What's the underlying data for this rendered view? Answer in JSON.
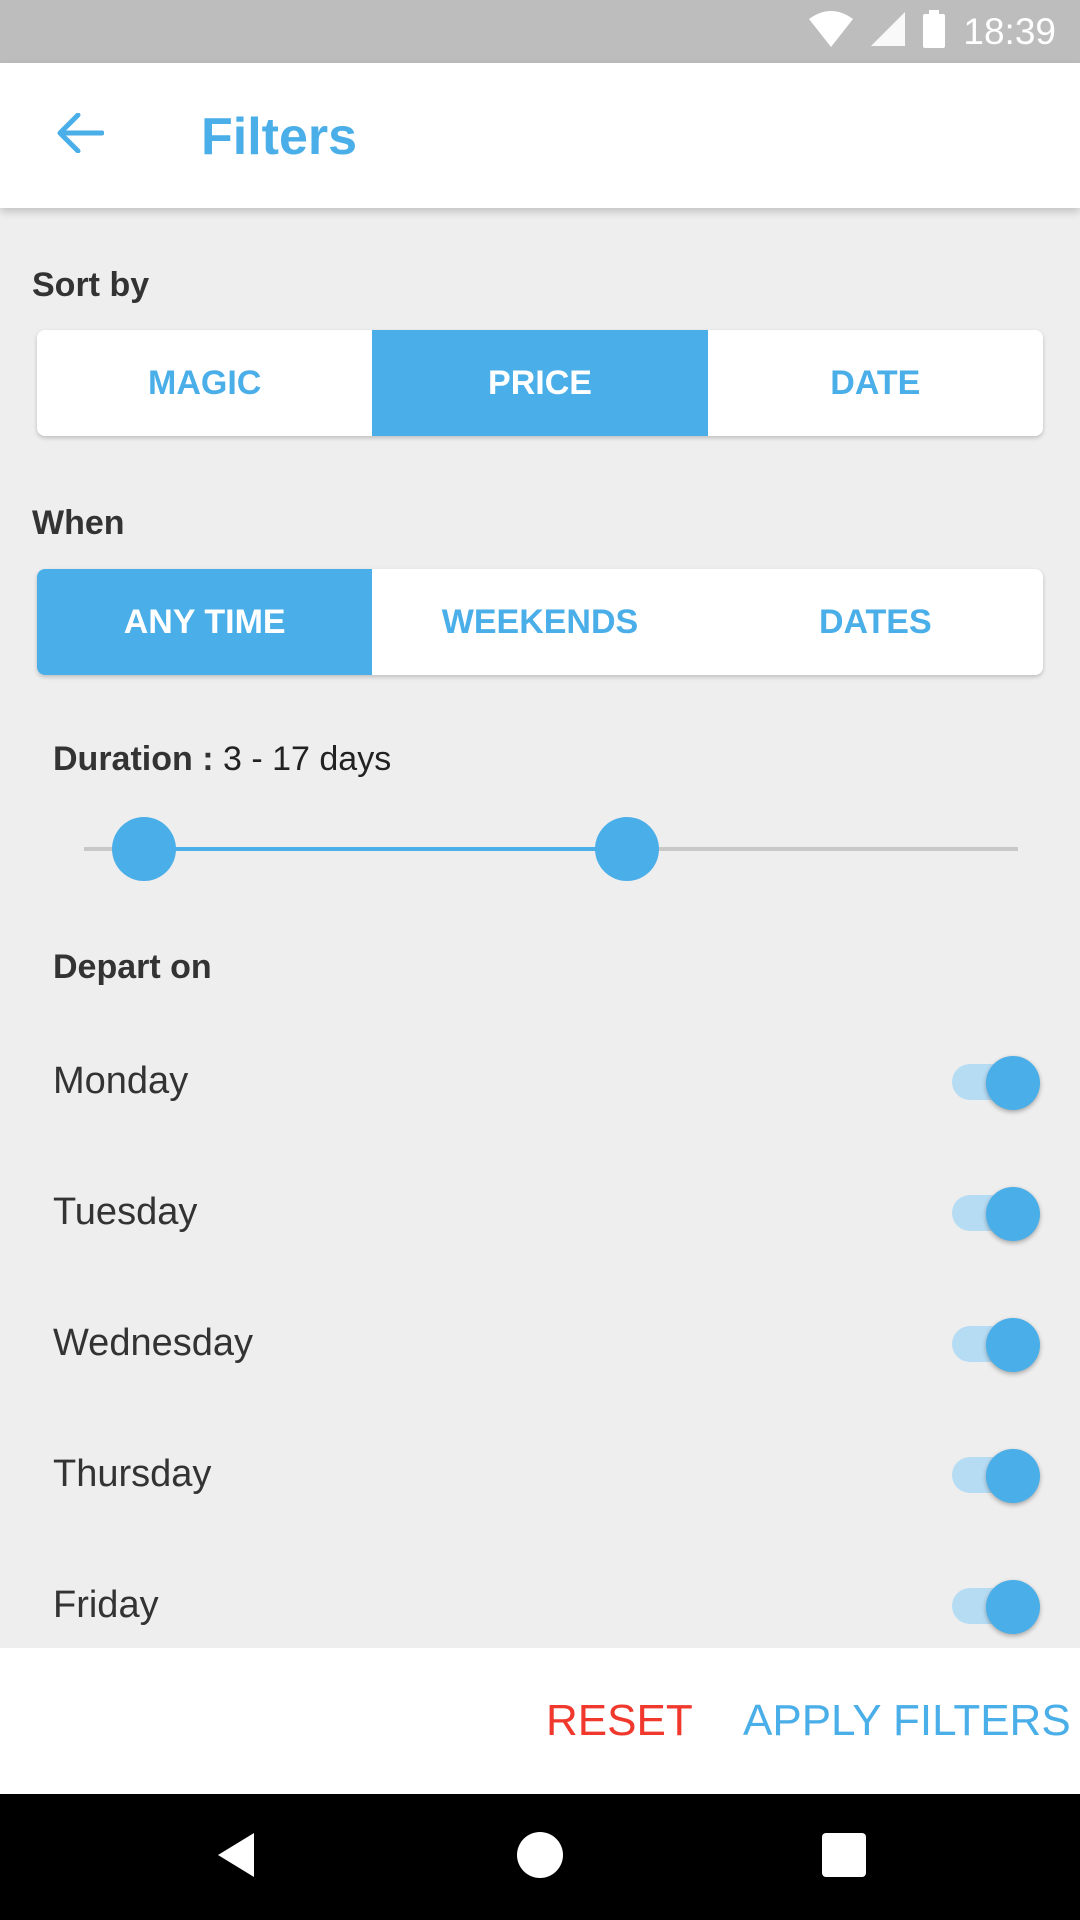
{
  "status_bar": {
    "time": "18:39",
    "icons": [
      "wifi-icon",
      "cell-signal-icon",
      "battery-icon"
    ]
  },
  "app_bar": {
    "title": "Filters",
    "back_icon": "arrow-back-icon"
  },
  "sort_by": {
    "label": "Sort by",
    "options": [
      "MAGIC",
      "PRICE",
      "DATE"
    ],
    "selected": "PRICE"
  },
  "when": {
    "label": "When",
    "options": [
      "ANY TIME",
      "WEEKENDS",
      "DATES"
    ],
    "selected": "ANY TIME"
  },
  "duration": {
    "label": "Duration :",
    "value_text": "3 - 17 days",
    "min": 3,
    "max": 17
  },
  "depart_on": {
    "label": "Depart on",
    "days": [
      {
        "name": "Monday",
        "enabled": true
      },
      {
        "name": "Tuesday",
        "enabled": true
      },
      {
        "name": "Wednesday",
        "enabled": true
      },
      {
        "name": "Thursday",
        "enabled": true
      },
      {
        "name": "Friday",
        "enabled": true
      }
    ]
  },
  "actions": {
    "reset": "RESET",
    "apply": "APPLY FILTERS"
  },
  "nav_bar": {
    "icons": [
      "nav-back-icon",
      "nav-home-icon",
      "nav-recents-icon"
    ]
  },
  "colors": {
    "accent": "#4aaee8",
    "reset": "#f0382c",
    "switch_track": "#b6dcf4"
  }
}
